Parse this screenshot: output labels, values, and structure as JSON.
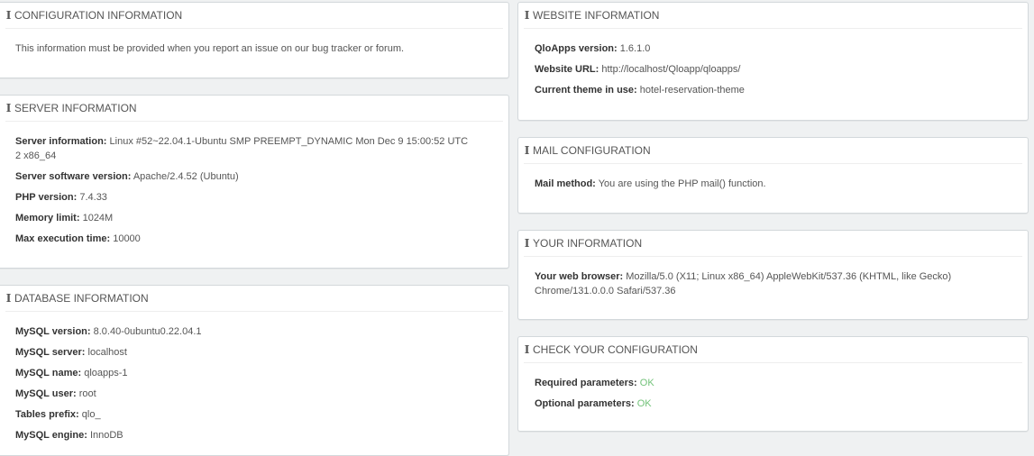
{
  "config": {
    "title": "CONFIGURATION INFORMATION",
    "text": "This information must be provided when you report an issue on our bug tracker or forum."
  },
  "server": {
    "title": "SERVER INFORMATION",
    "rows": [
      {
        "label": "Server information:",
        "value": "Linux #52~22.04.1-Ubuntu SMP PREEMPT_DYNAMIC Mon Dec 9 15:00:52 UTC 2 x86_64"
      },
      {
        "label": "Server software version:",
        "value": "Apache/2.4.52 (Ubuntu)"
      },
      {
        "label": "PHP version:",
        "value": "7.4.33"
      },
      {
        "label": "Memory limit:",
        "value": "1024M"
      },
      {
        "label": "Max execution time:",
        "value": "10000"
      }
    ]
  },
  "database": {
    "title": "DATABASE INFORMATION",
    "rows": [
      {
        "label": "MySQL version:",
        "value": "8.0.40-0ubuntu0.22.04.1"
      },
      {
        "label": "MySQL server:",
        "value": "localhost"
      },
      {
        "label": "MySQL name:",
        "value": "qloapps-1"
      },
      {
        "label": "MySQL user:",
        "value": "root"
      },
      {
        "label": "Tables prefix:",
        "value": "qlo_"
      },
      {
        "label": "MySQL engine:",
        "value": "InnoDB"
      }
    ]
  },
  "website": {
    "title": "WEBSITE INFORMATION",
    "rows": [
      {
        "label": "QloApps version:",
        "value": "1.6.1.0"
      },
      {
        "label": "Website URL:",
        "value": "http://localhost/Qloapp/qloapps/"
      },
      {
        "label": "Current theme in use:",
        "value": "hotel-reservation-theme"
      }
    ]
  },
  "mail": {
    "title": "MAIL CONFIGURATION",
    "rows": [
      {
        "label": "Mail method:",
        "value": "You are using the PHP mail() function."
      }
    ]
  },
  "you": {
    "title": "YOUR INFORMATION",
    "rows": [
      {
        "label": "Your web browser:",
        "value": "Mozilla/5.0 (X11; Linux x86_64) AppleWebKit/537.36 (KHTML, like Gecko) Chrome/131.0.0.0 Safari/537.36"
      }
    ]
  },
  "check": {
    "title": "CHECK YOUR CONFIGURATION",
    "rows": [
      {
        "label": "Required parameters:",
        "value": "OK"
      },
      {
        "label": "Optional parameters:",
        "value": "OK"
      }
    ]
  },
  "icon": "i",
  "colors": {
    "ok": "#72c279",
    "label": "#333333",
    "text": "#555555",
    "border": "#d3d8db",
    "background": "#eff1f2"
  }
}
